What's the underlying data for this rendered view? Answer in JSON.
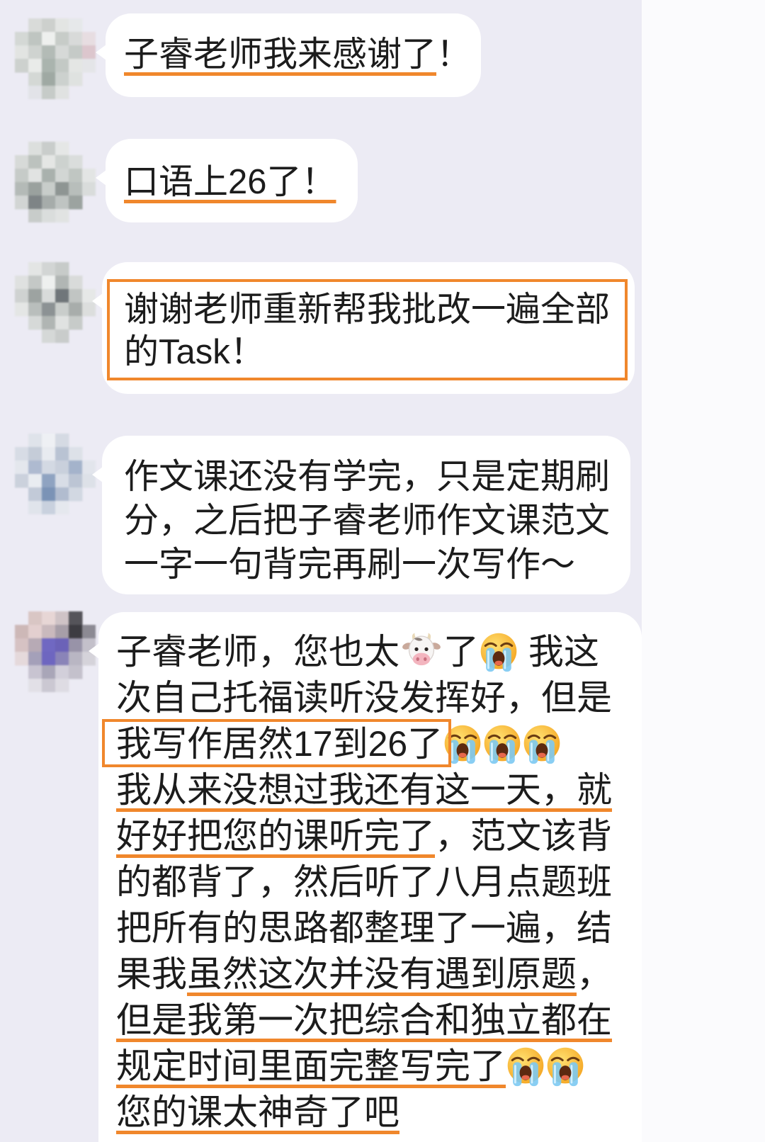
{
  "colors": {
    "background": "#ecebf4",
    "bubble": "#ffffff",
    "highlight": "#f0872c",
    "text": "#1c1c1c"
  },
  "chat": {
    "messages": [
      {
        "lines": [
          [
            {
              "text": "子睿老师我来感谢了",
              "underlined": true
            },
            {
              "text": "！"
            }
          ]
        ]
      },
      {
        "lines": [
          [
            {
              "text": "口语上26了！",
              "underlined": true
            }
          ]
        ]
      },
      {
        "boxed": true,
        "lines": [
          [
            {
              "text": "谢谢老师重新帮我批改一遍全部"
            }
          ],
          [
            {
              "text": "的Task！"
            }
          ]
        ]
      },
      {
        "lines": [
          [
            {
              "text": "作文课还没有学完，只是定期刷"
            }
          ],
          [
            {
              "text": "分，之后把子睿老师作文课范文"
            }
          ],
          [
            {
              "text": "一字一句背完再刷一次写作～"
            }
          ]
        ]
      },
      {
        "lines": [
          [
            {
              "text": "子睿老师，您也太"
            },
            {
              "icon": "cow-face"
            },
            {
              "text": "了"
            },
            {
              "icon": "loudly-crying-face"
            },
            {
              "text": " 我这"
            }
          ],
          [
            {
              "text": "次自己托福读听没发挥好，但是"
            }
          ],
          [
            {
              "text": "我写作居然17到26了",
              "boxed": true
            },
            {
              "icon": "loudly-crying-face"
            },
            {
              "icon": "loudly-crying-face"
            },
            {
              "icon": "loudly-crying-face"
            }
          ],
          [
            {
              "text": "我从来没想过我还有这一天，就",
              "underlined": true
            }
          ],
          [
            {
              "text": "好好把您的课听完了",
              "underlined": true
            },
            {
              "text": "，范文该背"
            }
          ],
          [
            {
              "text": "的都背了，然后听了八月点题班"
            }
          ],
          [
            {
              "text": "把所有的思路都整理了一遍，结"
            }
          ],
          [
            {
              "text": "果我"
            },
            {
              "text": "虽然这次并没有遇到原题",
              "underlined": true
            },
            {
              "text": "，"
            }
          ],
          [
            {
              "text": "但是我第一次把综合和独立都在",
              "underlined": true
            }
          ],
          [
            {
              "text": "规定时间里面完整写完了",
              "underlined": true
            },
            {
              "icon": "loudly-crying-face"
            },
            {
              "icon": "loudly-crying-face"
            }
          ],
          [
            {
              "text": "您的课太神奇了吧",
              "underlined": true
            }
          ]
        ]
      }
    ]
  }
}
